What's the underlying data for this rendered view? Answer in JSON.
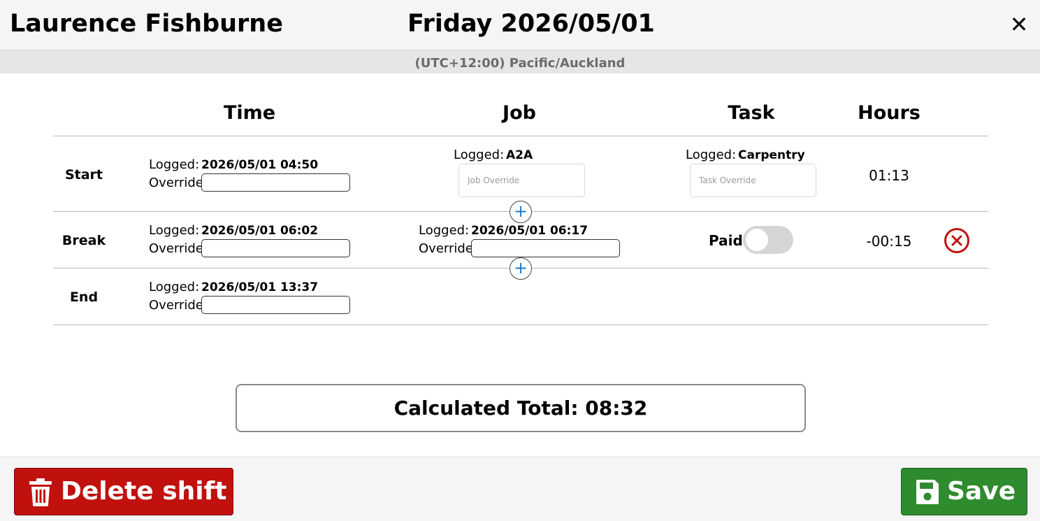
{
  "header": {
    "employee_name": "Laurence Fishburne",
    "date_title": "Friday 2026/05/01",
    "close_label": "✕"
  },
  "timezone": "(UTC+12:00) Pacific/Auckland",
  "columns": {
    "time": "Time",
    "job": "Job",
    "task": "Task",
    "hours": "Hours"
  },
  "labels": {
    "logged": "Logged:",
    "override": "Override:",
    "paid": "Paid"
  },
  "rows": {
    "start": {
      "label": "Start",
      "logged_time": "2026/05/01 04:50",
      "override_value": "",
      "job_logged": "A2A",
      "job_placeholder": "Job Override",
      "task_logged": "Carpentry",
      "task_placeholder": "Task Override",
      "hours": "01:13"
    },
    "break": {
      "label": "Break",
      "logged_start": "2026/05/01 06:02",
      "override_start": "",
      "logged_end": "2026/05/01 06:17",
      "override_end": "",
      "paid": false,
      "hours": "-00:15"
    },
    "end": {
      "label": "End",
      "logged_time": "2026/05/01 13:37",
      "override_value": ""
    }
  },
  "add_label": "+",
  "total": "Calculated Total: 08:32",
  "footer": {
    "delete_label": "Delete shift",
    "save_label": "Save"
  },
  "colors": {
    "delete": "#c0110f",
    "save": "#2e8b2e",
    "add_icon": "#1e7ac4",
    "remove_icon": "#c0110f"
  },
  "icons": {
    "close": "close-icon",
    "add": "plus-icon",
    "remove": "remove-circle-icon",
    "delete": "trash-icon",
    "save": "floppy-disk-icon"
  }
}
